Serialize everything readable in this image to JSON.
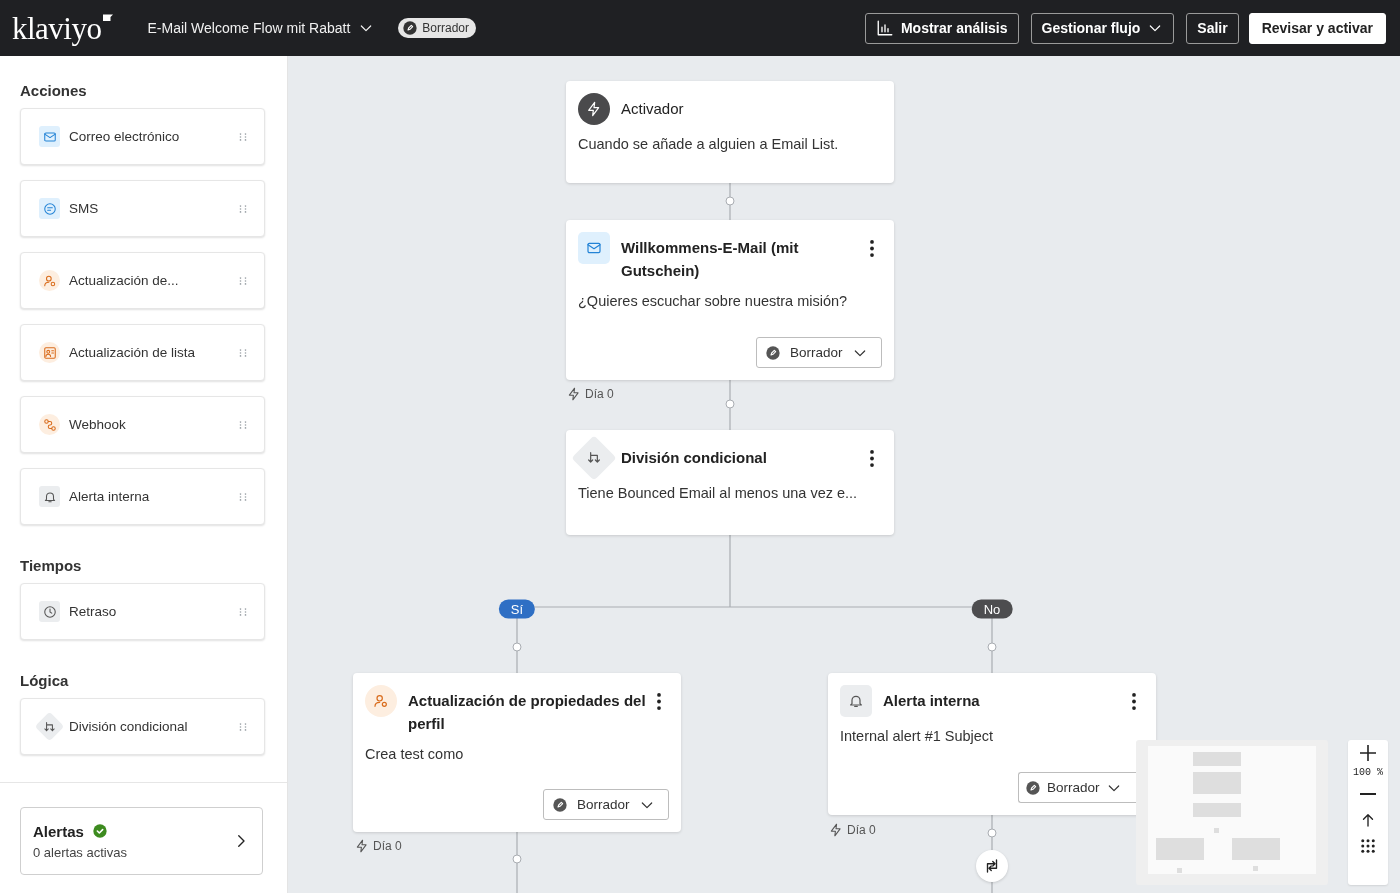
{
  "header": {
    "logo": "klaviyo",
    "flow_title": "E-Mail Welcome Flow mit Rabatt",
    "status_badge": "Borrador",
    "buttons": [
      {
        "label": "Mostrar análisis",
        "kind": "analytics"
      },
      {
        "label": "Gestionar flujo",
        "kind": "dropdown"
      },
      {
        "label": "Salir",
        "kind": "plain"
      },
      {
        "label": "Revisar y activar",
        "kind": "primary"
      }
    ]
  },
  "sidebar": {
    "sections": [
      {
        "title": "Acciones",
        "items": [
          {
            "label": "Correo electrónico",
            "kind": "email"
          },
          {
            "label": "SMS",
            "kind": "sms"
          },
          {
            "label": "Actualización de...",
            "kind": "profile"
          },
          {
            "label": "Actualización de lista",
            "kind": "list"
          },
          {
            "label": "Webhook",
            "kind": "webhook"
          },
          {
            "label": "Alerta interna",
            "kind": "alert"
          }
        ]
      },
      {
        "title": "Tiempos",
        "items": [
          {
            "label": "Retraso",
            "kind": "delay"
          }
        ]
      },
      {
        "title": "Lógica",
        "items": [
          {
            "label": "División condicional",
            "kind": "split"
          }
        ]
      }
    ],
    "alerts": {
      "title": "Alertas",
      "subtitle": "0 alertas activas"
    }
  },
  "canvas": {
    "nodes": [
      {
        "kind": "trigger",
        "title": "Activador",
        "description": "Cuando se añade a alguien a Email List."
      },
      {
        "kind": "email",
        "title": "Willkommens-E-Mail (mit Gutschein)",
        "description": "¿Quieres escuchar sobre nuestra misión?",
        "status": "Borrador",
        "day": "Día 0"
      },
      {
        "kind": "split",
        "title": "División condicional",
        "description": "Tiene Bounced Email al menos una vez e..."
      },
      {
        "kind": "profile",
        "title": "Actualización de propiedades del perfil",
        "description": "Crea test como",
        "status": "Borrador",
        "day": "Día 0"
      },
      {
        "kind": "alert",
        "title": "Alerta interna",
        "description": "Internal alert #1 Subject",
        "status": "Borrador",
        "day": "Día 0"
      }
    ],
    "branches": [
      {
        "label": "Sí",
        "color": "#2f6fc4"
      },
      {
        "label": "No",
        "color": "#4d4d4f"
      }
    ],
    "zoom": {
      "level_text": "100 %"
    }
  }
}
